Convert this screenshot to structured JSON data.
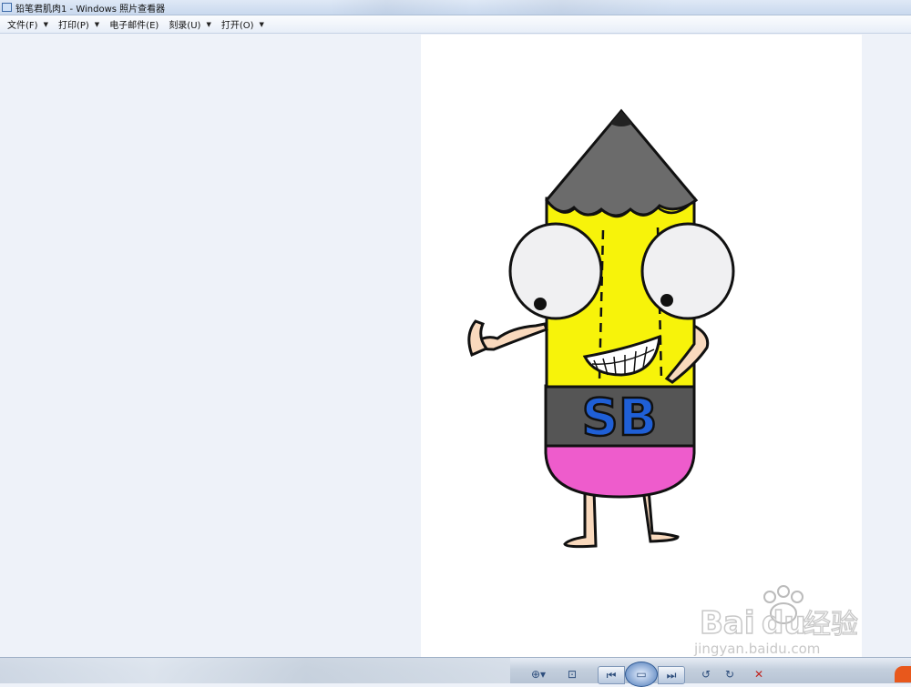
{
  "window": {
    "title": "铅笔君肌肉1 - Windows 照片查看器"
  },
  "menu": [
    {
      "label": "文件(F)"
    },
    {
      "label": "打印(P)"
    },
    {
      "label": "电子邮件(E)"
    },
    {
      "label": "刻录(U)"
    },
    {
      "label": "打开(O)"
    }
  ],
  "image": {
    "badge_text": "SB",
    "colors": {
      "pencil_yellow": "#f7f30a",
      "pencil_tip": "#6b6b6b",
      "band": "#555555",
      "eraser": "#ee5ccc",
      "skin": "#f9d9bd",
      "letters": "#1f5fd6"
    }
  },
  "watermark": {
    "brand": "Bai",
    "brand2": "du",
    "suffix": "经验",
    "url": "jingyan.baidu.com"
  },
  "toolbar": {
    "zoom_icon": "zoom-icon",
    "fit_icon": "actual-size-icon",
    "prev_icon": "previous-icon",
    "slideshow_icon": "slideshow-icon",
    "next_icon": "next-icon",
    "rotate_left_icon": "rotate-left-icon",
    "rotate_right_icon": "rotate-right-icon",
    "delete_icon": "delete-icon"
  }
}
